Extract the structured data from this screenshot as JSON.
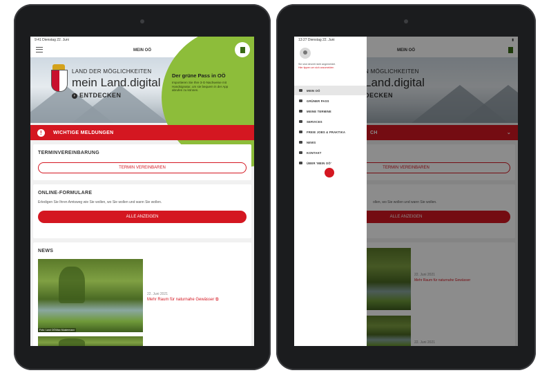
{
  "left_tablet": {
    "status_time": "9:41  Dienstag 22. Juni",
    "title": "MEIN OÖ",
    "hero": {
      "line1": "LAND DER MÖGLICHKEITEN",
      "line2": "mein Land.digital",
      "line3": "ENTDECKEN",
      "green_title": "Der grüne Pass in OÖ",
      "green_text": "Importieren Sie Ihre 3-G-Nachweise mit Handsignatur, um sie bequem in der App abrufen zu können."
    },
    "alert": "WICHTIGE MELDUNGEN",
    "termin": {
      "heading": "TERMINVEREINBARUNG",
      "button": "TERMIN VEREINBAREN"
    },
    "forms": {
      "heading": "ONLINE-FORMULARE",
      "text": "Erledigen Sie Ihren Amtsweg wie Sie wollen, wo Sie wollen und wann Sie wollen.",
      "button": "ALLE ANZEIGEN"
    },
    "news": {
      "heading": "NEWS",
      "date": "22. Juni 2021",
      "link": "Mehr Raum für naturnahe Gewässer",
      "caption": "Foto: Land OÖ/Max Mustermann"
    }
  },
  "right_tablet": {
    "status_time": "13:27  Dienstag 22. Juni",
    "title": "MEIN OÖ",
    "drawer": {
      "note_line1": "Sie sind derzeit nicht angemeldet.",
      "note_line2": "Hier tippen um sich anzumelden",
      "items": [
        "MEIN OÖ",
        "GRÜNER PASS",
        "MEINE TERMINE",
        "SERVICES",
        "FREIE JOBS & PRAKTIKA",
        "NEWS",
        "KONTAKT",
        "ÜBER 'MEIN OÖ'"
      ]
    },
    "behind": {
      "hero_line1": "N MÖGLICHKEITEN",
      "hero_line2": "Land.digital",
      "hero_line3": "DECKEN",
      "alert": "CH",
      "termin_button": "TERMIN VEREINBAREN",
      "forms_text": "ollen, wo Sie wollen und wann Sie wollen.",
      "forms_button": "ALLE ANZEIGEN",
      "news_date": "22. Juni 2021",
      "news_link": "Mehr Raum für naturnahe Gewässer",
      "news_date2": "22. Juni 2021"
    }
  },
  "colors": {
    "accent": "#d41721",
    "green": "#8dbd3a",
    "bezel": "#1b1c1e"
  }
}
